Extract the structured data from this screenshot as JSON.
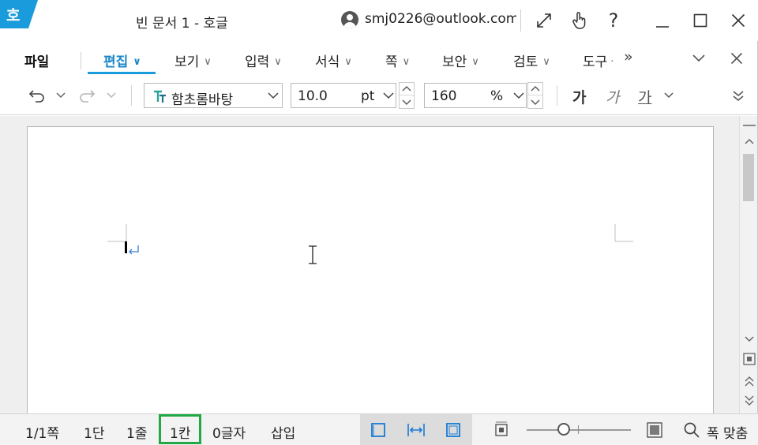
{
  "titlebar": {
    "app_badge": "호",
    "doc_title": "빈 문서 1 - 호글",
    "account_email": "smj0226@outlook.com",
    "buttons": [
      "restore-expand-icon",
      "touch-mode-icon",
      "help-icon",
      "minimize-icon",
      "maximize-icon",
      "close-icon"
    ],
    "help_glyph": "?"
  },
  "menubar": {
    "file_label": "파일",
    "tabs": [
      {
        "label": "편집",
        "active": true
      },
      {
        "label": "보기"
      },
      {
        "label": "입력"
      },
      {
        "label": "서식"
      },
      {
        "label": "쪽"
      },
      {
        "label": "보안"
      },
      {
        "label": "검토"
      },
      {
        "label": "도구"
      }
    ],
    "more_glyph": "»",
    "collapse_glyph": "⌄",
    "close_glyph": "✕"
  },
  "toolbar": {
    "font_name": "함초롬바탕",
    "font_size": "10.0",
    "font_unit": "pt",
    "line_spacing": "160",
    "line_spacing_unit": "%",
    "bold_glyph": "가",
    "italic_glyph": "가",
    "underline_glyph": "가"
  },
  "statusbar": {
    "page": "1/1쪽",
    "column": "1단",
    "line": "1줄",
    "cell": "1칸",
    "char_count": "0글자",
    "insert_mode": "삽입",
    "fit_label": "폭 맞춤"
  },
  "colors": {
    "accent": "#1a9bdc",
    "active_tab": "#1a86c8",
    "highlight_box": "#22a845",
    "view_icon": "#1a7bd4"
  }
}
